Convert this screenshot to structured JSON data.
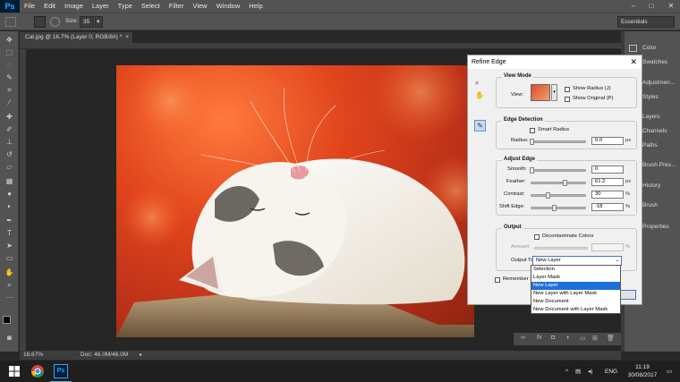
{
  "menubar": {
    "logo": "Ps",
    "items": [
      "File",
      "Edit",
      "Image",
      "Layer",
      "Type",
      "Select",
      "Filter",
      "View",
      "Window",
      "Help"
    ],
    "controls": [
      "–",
      "□",
      "✕"
    ]
  },
  "optionsbar": {
    "size_label": "Size:",
    "size_value": "35",
    "workspace": "Essentials"
  },
  "document": {
    "tab_title": "Cat.jpg @ 16.7% (Layer 0, RGB/8#) *",
    "tab_close": "×",
    "zoom": "16.67%",
    "doc_size": "Doc: 46.0M/46.0M"
  },
  "panels": {
    "items": [
      "Color",
      "Swatches",
      "Adjustmen...",
      "Styles",
      "Layers",
      "Channels",
      "Paths",
      "Brush Pres...",
      "History",
      "Brush",
      "Properties"
    ]
  },
  "dialog": {
    "title": "Refine Edge",
    "close": "✕",
    "view_mode": {
      "title": "View Mode",
      "view_label": "View:",
      "show_radius": "Show Radius (J)",
      "show_original": "Show Original (P)"
    },
    "edge_detection": {
      "title": "Edge Detection",
      "smart_radius": "Smart Radius",
      "radius_label": "Radius:",
      "radius_value": "0.0",
      "radius_unit": "px",
      "radius_level": 0.0
    },
    "adjust_edge": {
      "title": "Adjust Edge",
      "smooth_label": "Smooth:",
      "smooth_value": "0",
      "smooth_level": 0.0,
      "feather_label": "Feather:",
      "feather_value": "61.2",
      "feather_unit": "px",
      "feather_level": 0.62,
      "contrast_label": "Contrast:",
      "contrast_value": "30",
      "contrast_unit": "%",
      "contrast_level": 0.3,
      "shift_label": "Shift Edge:",
      "shift_value": "-18",
      "shift_unit": "%",
      "shift_level": 0.41
    },
    "output": {
      "title": "Output",
      "decontaminate": "Decontaminate Colors",
      "amount_label": "Amount:",
      "amount_unit": "%",
      "output_to_label": "Output To:",
      "output_to_value": "New Layer",
      "options": [
        "Selection",
        "Layer Mask",
        "New Layer",
        "New Layer with Layer Mask",
        "New Document",
        "New Document with Layer Mask"
      ],
      "selected_index": 2
    },
    "remember": "Remember Se"
  },
  "taskbar": {
    "lang": "ENG",
    "time": "11:19",
    "date": "30/08/2017",
    "tray_arrow": "^"
  },
  "colors": {
    "ps_blue": "#31a8ff",
    "selection_blue": "#1e70d6",
    "chrome": "#535353"
  }
}
